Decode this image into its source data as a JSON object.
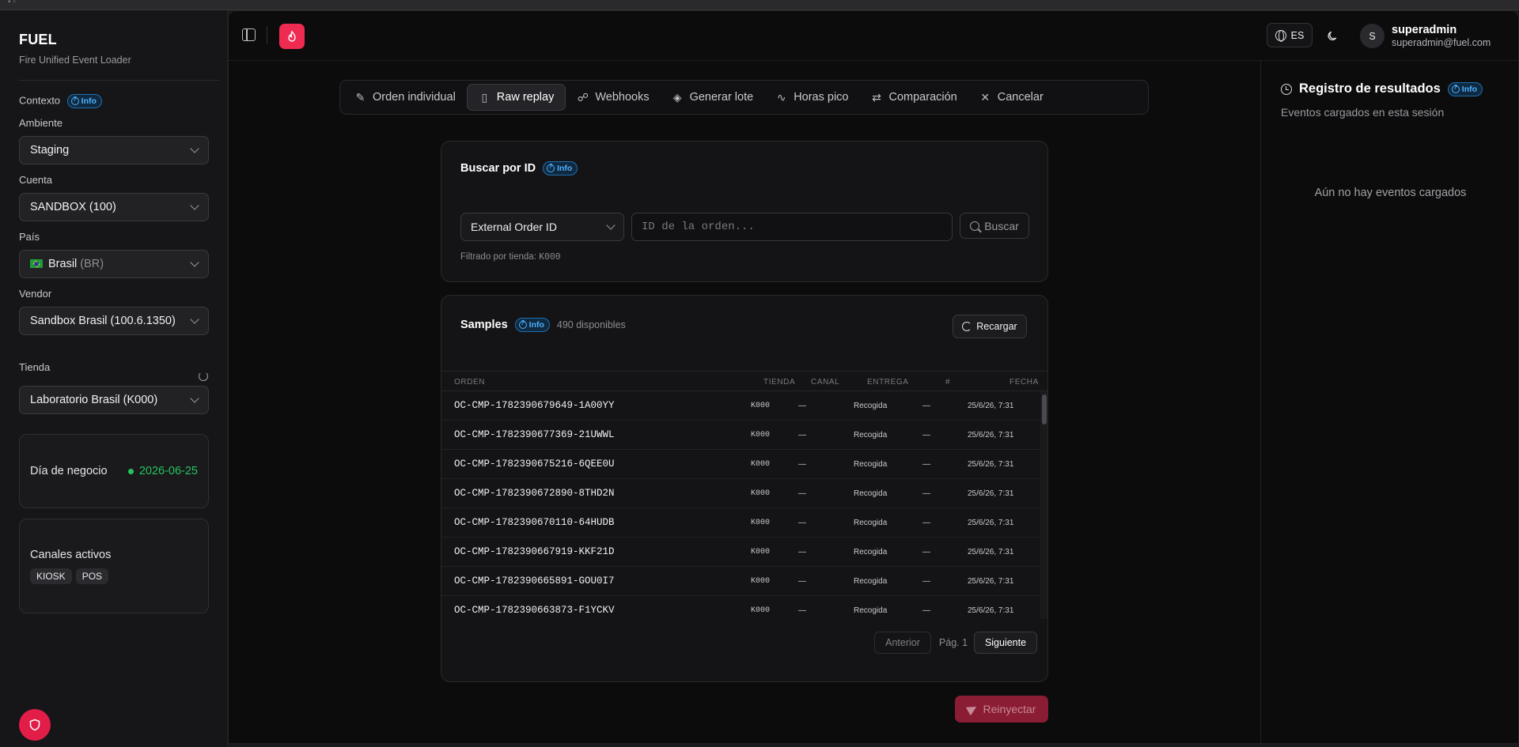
{
  "sidebar": {
    "brand_title": "FUEL",
    "brand_subtitle": "Fire Unified Event Loader",
    "context_label": "Contexto",
    "info_label": "Info",
    "ambiente_label": "Ambiente",
    "ambiente_value": "Staging",
    "cuenta_label": "Cuenta",
    "cuenta_value": "SANDBOX (100)",
    "pais_label": "País",
    "pais_value": "Brasil",
    "pais_code": "(BR)",
    "vendor_label": "Vendor",
    "vendor_value": "Sandbox Brasil (100.6.1350)",
    "tienda_label": "Tienda",
    "tienda_value": "Laboratorio Brasil (K000)",
    "business_day_label": "Día de negocio",
    "business_day_value": "2026-06-25",
    "channels_label": "Canales activos",
    "channels": [
      "KIOSK",
      "POS"
    ]
  },
  "header": {
    "lang": "ES",
    "avatar_initial": "S",
    "user_name": "superadmin",
    "user_email": "superadmin@fuel.com",
    "accent_color": "#ef2b52"
  },
  "tabs": [
    {
      "label": "Orden individual",
      "icon": "pencil-icon"
    },
    {
      "label": "Raw replay",
      "icon": "file-icon",
      "active": true
    },
    {
      "label": "Webhooks",
      "icon": "webhook-icon"
    },
    {
      "label": "Generar lote",
      "icon": "layers-icon"
    },
    {
      "label": "Horas pico",
      "icon": "activity-icon"
    },
    {
      "label": "Comparación",
      "icon": "compare-icon"
    },
    {
      "label": "Cancelar",
      "icon": "close-icon"
    }
  ],
  "search": {
    "title": "Buscar por ID",
    "info_label": "Info",
    "id_type": "External Order ID",
    "placeholder": "ID de la orden...",
    "button": "Buscar",
    "filter_prefix": "Filtrado por tienda:",
    "filter_store": "K000"
  },
  "samples": {
    "title": "Samples",
    "info_label": "Info",
    "available": "490 disponibles",
    "reload": "Recargar",
    "columns": {
      "orden": "ORDEN",
      "tienda": "TIENDA",
      "canal": "CANAL",
      "entrega": "ENTREGA",
      "num": "#",
      "fecha": "FECHA"
    },
    "rows": [
      {
        "orden": "OC-CMP-1782390679649-1A00YY",
        "tienda": "K000",
        "canal": "—",
        "entrega": "Recogida",
        "num": "—",
        "fecha": "25/6/26, 7:31"
      },
      {
        "orden": "OC-CMP-1782390677369-21UWWL",
        "tienda": "K000",
        "canal": "—",
        "entrega": "Recogida",
        "num": "—",
        "fecha": "25/6/26, 7:31"
      },
      {
        "orden": "OC-CMP-1782390675216-6QEE0U",
        "tienda": "K000",
        "canal": "—",
        "entrega": "Recogida",
        "num": "—",
        "fecha": "25/6/26, 7:31"
      },
      {
        "orden": "OC-CMP-1782390672890-8THD2N",
        "tienda": "K000",
        "canal": "—",
        "entrega": "Recogida",
        "num": "—",
        "fecha": "25/6/26, 7:31"
      },
      {
        "orden": "OC-CMP-1782390670110-64HUDB",
        "tienda": "K000",
        "canal": "—",
        "entrega": "Recogida",
        "num": "—",
        "fecha": "25/6/26, 7:31"
      },
      {
        "orden": "OC-CMP-1782390667919-KKF21D",
        "tienda": "K000",
        "canal": "—",
        "entrega": "Recogida",
        "num": "—",
        "fecha": "25/6/26, 7:31"
      },
      {
        "orden": "OC-CMP-1782390665891-GOU0I7",
        "tienda": "K000",
        "canal": "—",
        "entrega": "Recogida",
        "num": "—",
        "fecha": "25/6/26, 7:31"
      },
      {
        "orden": "OC-CMP-1782390663873-F1YCKV",
        "tienda": "K000",
        "canal": "—",
        "entrega": "Recogida",
        "num": "—",
        "fecha": "25/6/26, 7:31"
      }
    ],
    "prev": "Anterior",
    "page": "Pág. 1",
    "next": "Siguiente"
  },
  "reinject": "Reinyectar",
  "results": {
    "title": "Registro de resultados",
    "info_label": "Info",
    "subtitle": "Eventos cargados en esta sesión",
    "empty": "Aún no hay eventos cargados"
  }
}
